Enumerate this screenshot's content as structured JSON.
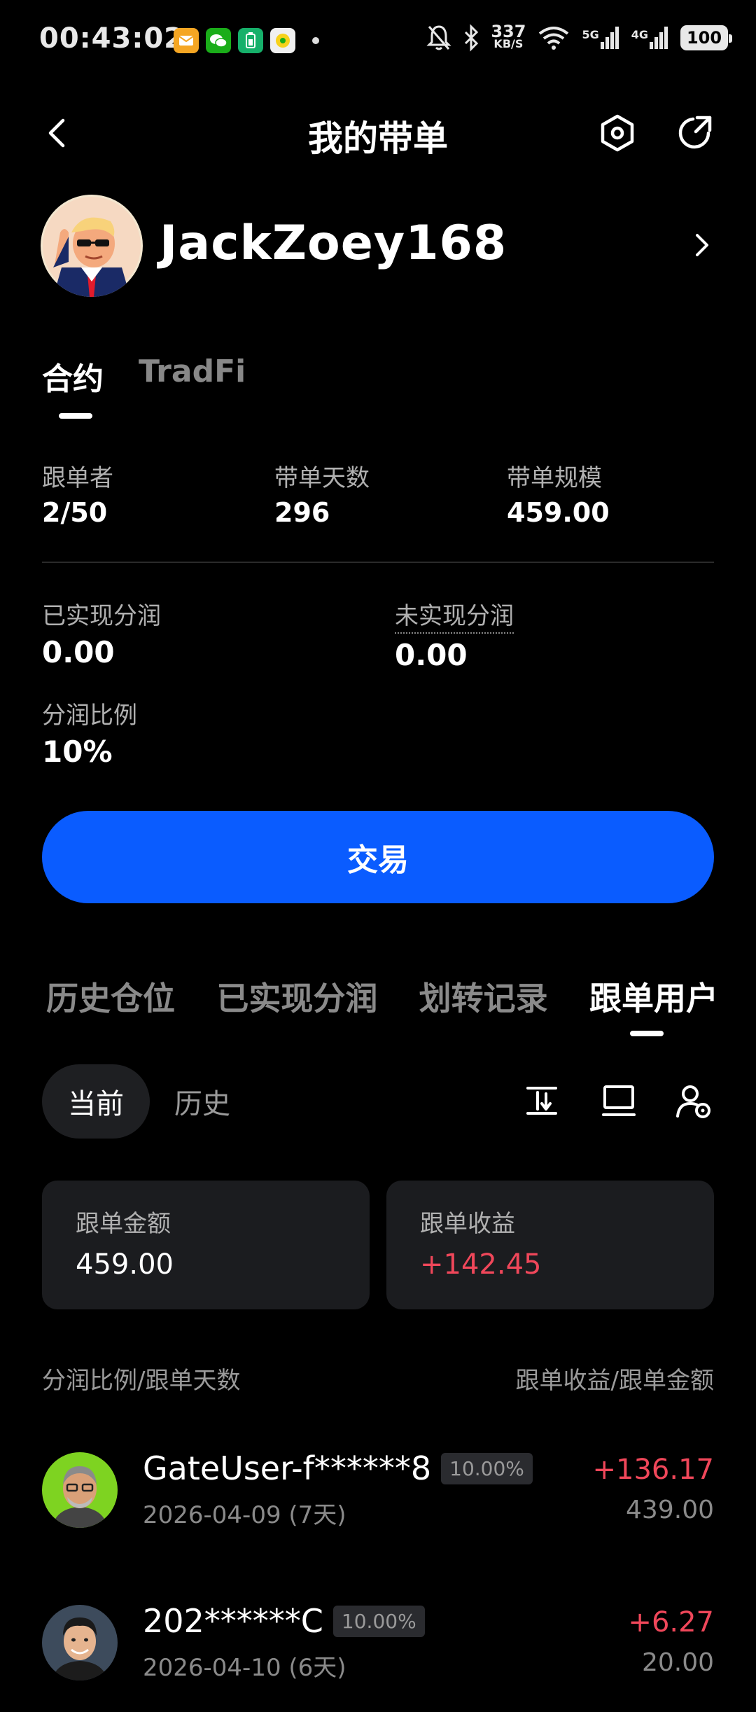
{
  "status_bar": {
    "time": "00:43:02",
    "net_speed_value": "337",
    "net_speed_unit": "KB/S",
    "signal1_label": "5G",
    "signal2_label": "4G",
    "battery": "100"
  },
  "header": {
    "title": "我的带单"
  },
  "profile": {
    "username": "JackZoey168"
  },
  "main_tabs": [
    {
      "label": "合约",
      "active": true
    },
    {
      "label": "TradFi",
      "active": false
    }
  ],
  "stats": {
    "followers_label": "跟单者",
    "followers_value": "2/50",
    "days_label": "带单天数",
    "days_value": "296",
    "scale_label": "带单规模",
    "scale_value": "459.00"
  },
  "profit_share": {
    "realized_label": "已实现分润",
    "realized_value": "0.00",
    "unrealized_label": "未实现分润",
    "unrealized_value": "0.00",
    "ratio_label": "分润比例",
    "ratio_value": "10%"
  },
  "trade_button": "交易",
  "sub_tabs": [
    {
      "label": "历史仓位",
      "active": false
    },
    {
      "label": "已实现分润",
      "active": false
    },
    {
      "label": "划转记录",
      "active": false
    },
    {
      "label": "跟单用户",
      "active": true
    }
  ],
  "segment": {
    "current": "当前",
    "history": "历史"
  },
  "summary_cards": {
    "amount_label": "跟单金额",
    "amount_value": "459.00",
    "profit_label": "跟单收益",
    "profit_value": "+142.45"
  },
  "list_header": {
    "left": "分润比例/跟单天数",
    "right": "跟单收益/跟单金额"
  },
  "followers": [
    {
      "name": "GateUser-f******8",
      "ratio": "10.00%",
      "date": "2026-04-09 (7天)",
      "profit": "+136.17",
      "amount": "439.00"
    },
    {
      "name": "202******C",
      "ratio": "10.00%",
      "date": "2026-04-10 (6天)",
      "profit": "+6.27",
      "amount": "20.00"
    }
  ],
  "colors": {
    "accent": "#0a5cff",
    "positive": "#f0475a",
    "background": "#000000",
    "card": "#1b1c1f"
  }
}
